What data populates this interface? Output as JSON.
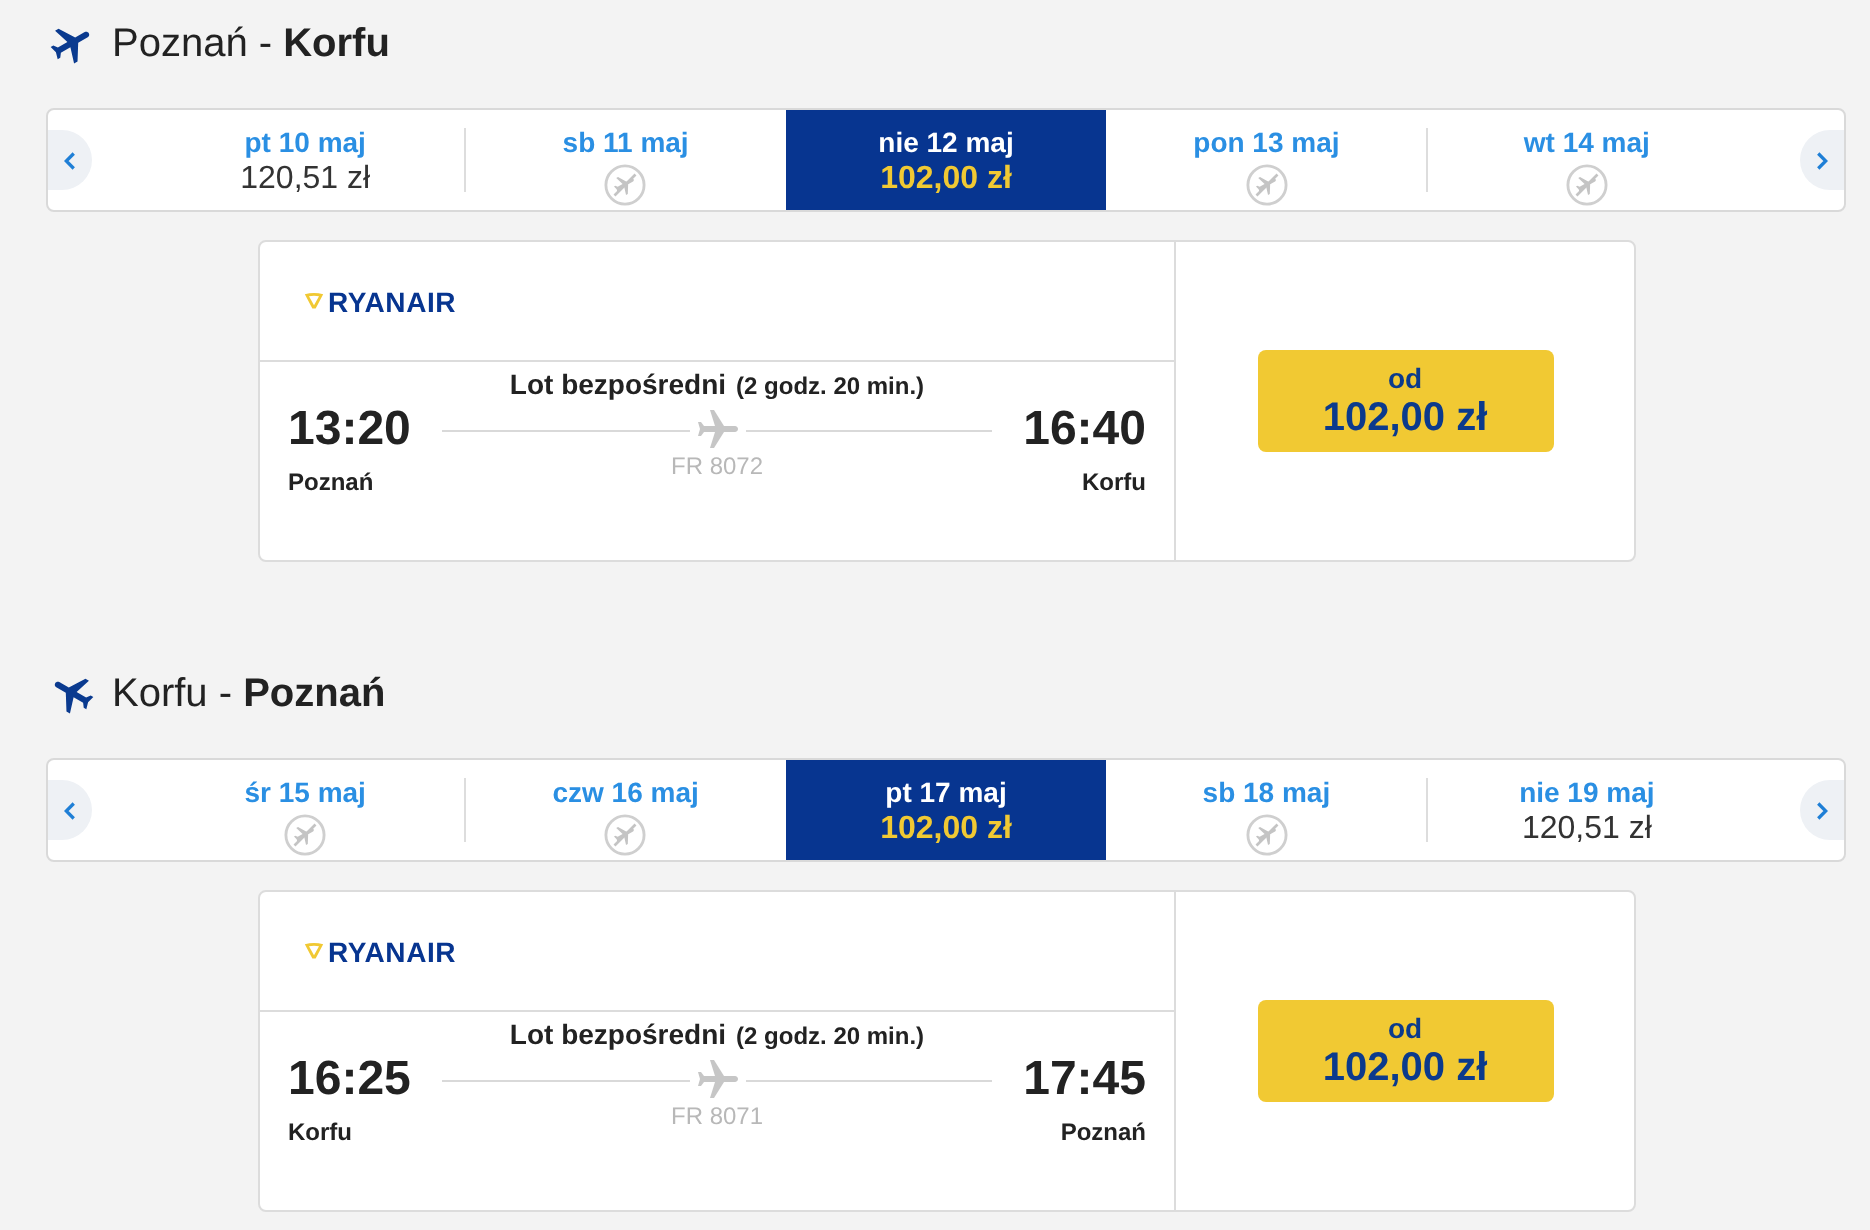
{
  "routes": [
    {
      "title": "Poznań - **Korfu**",
      "dates": [
        {
          "label": "pt 10 maj",
          "kind": "fare",
          "price": "120,51 zł",
          "selected": false
        },
        {
          "label": "sb 11 maj",
          "kind": "no_flight",
          "selected": false
        },
        {
          "label": "nie 12 maj",
          "kind": "fare",
          "price": "102,00 zł",
          "selected": true
        },
        {
          "label": "pon 13 maj",
          "kind": "no_flight",
          "selected": false
        },
        {
          "label": "wt 14 maj",
          "kind": "no_flight",
          "selected": false
        }
      ],
      "flight": {
        "airline": "RYANAIR",
        "departure": {
          "time": "13:20",
          "city": "Poznań"
        },
        "arrival": {
          "time": "16:40",
          "city": "Korfu"
        },
        "type": "Lot bezpośredni",
        "duration": "(2 godz. 20 min.)",
        "flight_number": "FR 8072"
      },
      "fare": {
        "prefix": "od",
        "amount": "102,00 zł"
      }
    },
    {
      "title": "Korfu - **Poznań**",
      "dates": [
        {
          "label": "śr 15 maj",
          "kind": "no_flight",
          "selected": false
        },
        {
          "label": "czw 16 maj",
          "kind": "no_flight",
          "selected": false
        },
        {
          "label": "pt 17 maj",
          "kind": "fare",
          "price": "102,00 zł",
          "selected": true
        },
        {
          "label": "sb 18 maj",
          "kind": "no_flight",
          "selected": false
        },
        {
          "label": "nie 19 maj",
          "kind": "fare",
          "price": "120,51 zł",
          "selected": false
        }
      ],
      "flight": {
        "airline": "RYANAIR",
        "departure": {
          "time": "16:25",
          "city": "Korfu"
        },
        "arrival": {
          "time": "17:45",
          "city": "Poznań"
        },
        "type": "Lot bezpośredni",
        "duration": "(2 godz. 20 min.)",
        "flight_number": "FR 8071"
      },
      "fare": {
        "prefix": "od",
        "amount": "102,00 zł"
      }
    }
  ]
}
